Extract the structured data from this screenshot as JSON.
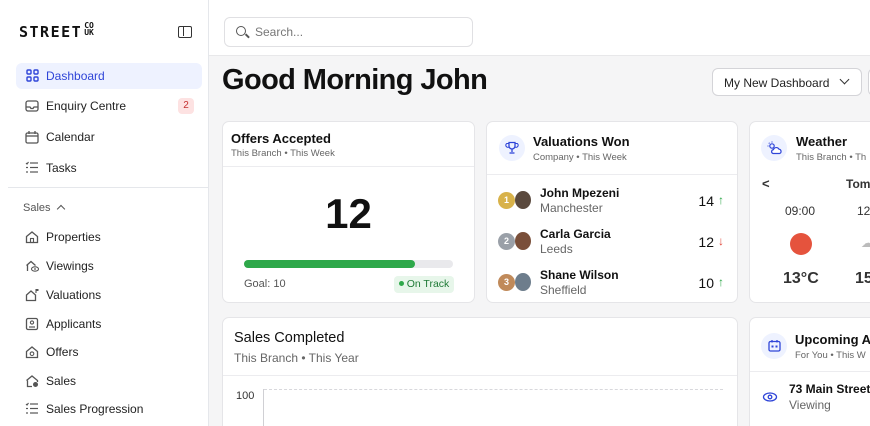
{
  "brand": {
    "name": "STREET",
    "suffix_line1": "CO",
    "suffix_line2": "UK"
  },
  "sidebar": {
    "items": [
      {
        "label": "Dashboard",
        "icon": "grid-icon"
      },
      {
        "label": "Enquiry Centre",
        "icon": "inbox-icon",
        "badge": "2"
      },
      {
        "label": "Calendar",
        "icon": "calendar-icon"
      },
      {
        "label": "Tasks",
        "icon": "list-icon"
      }
    ],
    "section": "Sales",
    "sales_items": [
      {
        "label": "Properties",
        "icon": "house-icon"
      },
      {
        "label": "Viewings",
        "icon": "eye-house-icon"
      },
      {
        "label": "Valuations",
        "icon": "house-flag-icon"
      },
      {
        "label": "Applicants",
        "icon": "id-card-icon"
      },
      {
        "label": "Offers",
        "icon": "house-offer-icon"
      },
      {
        "label": "Sales",
        "icon": "house-check-icon"
      },
      {
        "label": "Sales Progression",
        "icon": "progress-list-icon"
      }
    ]
  },
  "search": {
    "placeholder": "Search..."
  },
  "header": {
    "greeting": "Good Morning John",
    "dashboard_select": "My New Dashboard"
  },
  "offers": {
    "title": "Offers Accepted",
    "subtitle": "This Branch • This Week",
    "value": "12",
    "goal_label": "Goal: 10",
    "status": "On Track",
    "progress": 0.82,
    "colors": {
      "progress": "#2ea84a"
    }
  },
  "valuations": {
    "title": "Valuations Won",
    "subtitle": "Company • This Week",
    "rows": [
      {
        "rank": "1",
        "name": "John Mpezeni",
        "location": "Manchester",
        "score": "14",
        "trend": "↑",
        "trend_color": "#2ea84a",
        "rank_color": "#d8b24a"
      },
      {
        "rank": "2",
        "name": "Carla Garcia",
        "location": "Leeds",
        "score": "12",
        "trend": "↓",
        "trend_color": "#e0473a",
        "rank_color": "#9aa0a8"
      },
      {
        "rank": "3",
        "name": "Shane Wilson",
        "location": "Sheffield",
        "score": "10",
        "trend": "↑",
        "trend_color": "#2ea84a",
        "rank_color": "#c08a5a"
      }
    ]
  },
  "weather": {
    "title": "Weather",
    "subtitle": "This Branch • Th",
    "prev": "<",
    "day": "Tom",
    "times": [
      "09:00",
      "12"
    ],
    "temps": [
      "13°C",
      "15"
    ]
  },
  "sales_completed": {
    "title": "Sales Completed",
    "subtitle": "This Branch • This Year",
    "y_tick": "100"
  },
  "upcoming": {
    "title": "Upcoming Ap",
    "subtitle": "For You • This W",
    "item_address": "73 Main Street",
    "item_type": "Viewing"
  }
}
